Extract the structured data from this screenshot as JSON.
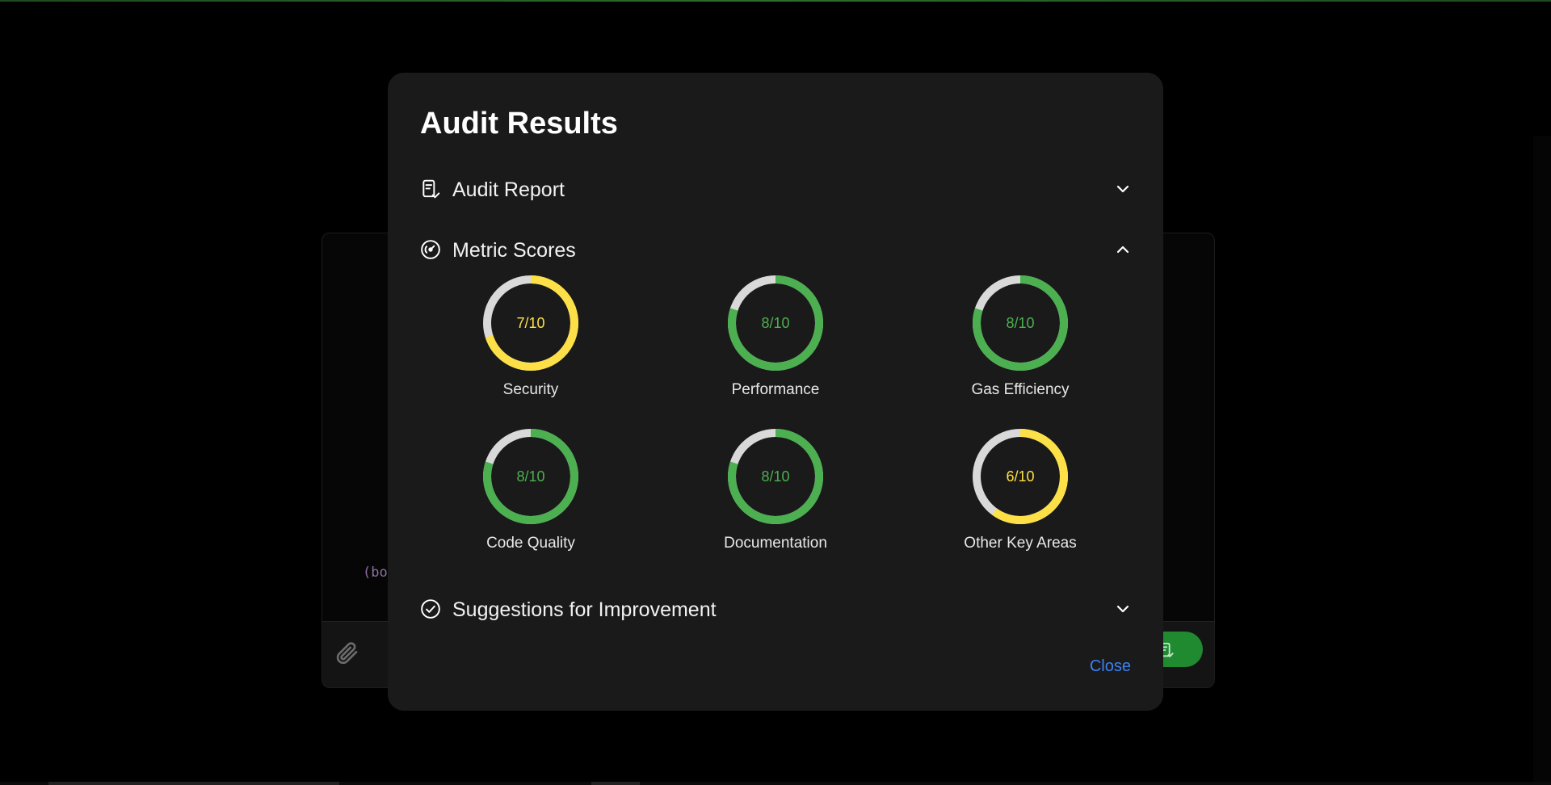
{
  "dialog": {
    "title": "Audit Results",
    "close_label": "Close"
  },
  "sections": {
    "audit_report": {
      "label": "Audit Report",
      "icon": "report-check-icon",
      "expanded": false
    },
    "metric_scores": {
      "label": "Metric Scores",
      "icon": "gauge-icon",
      "expanded": true
    },
    "suggestions": {
      "label": "Suggestions for Improvement",
      "icon": "circle-check-icon",
      "expanded": false
    }
  },
  "metrics": [
    {
      "label": "Security",
      "score_text": "7/10",
      "score": 7,
      "max": 10,
      "color": "#fde047"
    },
    {
      "label": "Performance",
      "score_text": "8/10",
      "score": 8,
      "max": 10,
      "color": "#4caf50"
    },
    {
      "label": "Gas Efficiency",
      "score_text": "8/10",
      "score": 8,
      "max": 10,
      "color": "#4caf50"
    },
    {
      "label": "Code Quality",
      "score_text": "8/10",
      "score": 8,
      "max": 10,
      "color": "#4caf50"
    },
    {
      "label": "Documentation",
      "score_text": "8/10",
      "score": 8,
      "max": 10,
      "color": "#4caf50"
    },
    {
      "label": "Other Key Areas",
      "score_text": "6/10",
      "score": 6,
      "max": 10,
      "color": "#fde047"
    }
  ],
  "background_editor": {
    "code_fragment": "(bo",
    "attach_icon": "paperclip-icon",
    "submit_icon": "report-check-icon"
  },
  "colors": {
    "ring_track": "#d9d9d9",
    "good": "#4caf50",
    "warn": "#fde047",
    "link": "#3b82f6"
  }
}
